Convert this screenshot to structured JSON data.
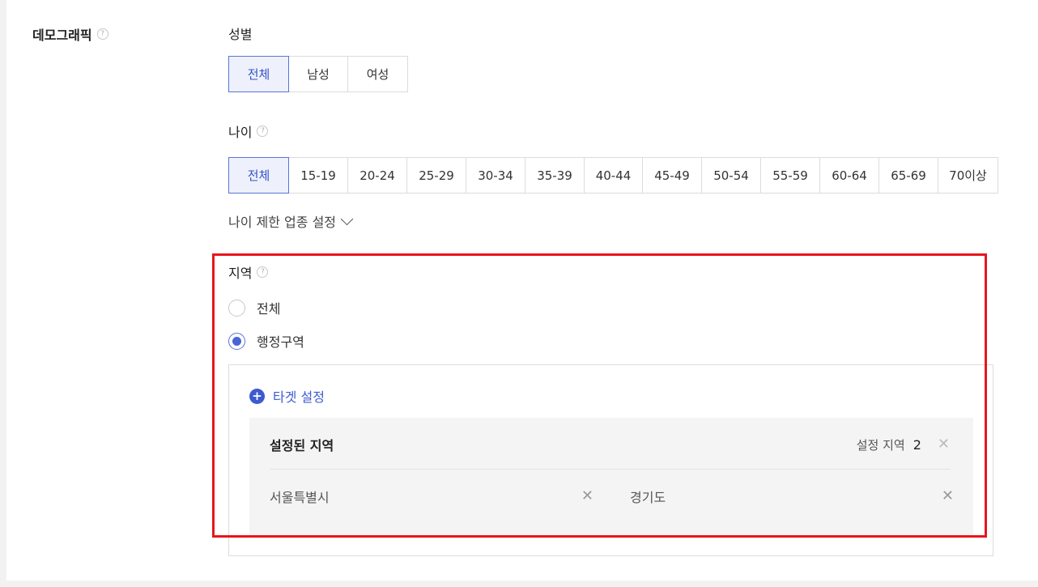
{
  "demographic": {
    "title": "데모그래픽",
    "help": "?"
  },
  "gender": {
    "label": "성별",
    "options": [
      "전체",
      "남성",
      "여성"
    ],
    "selected": "전체"
  },
  "age": {
    "label": "나이",
    "help": "?",
    "options": [
      "전체",
      "15-19",
      "20-24",
      "25-29",
      "30-34",
      "35-39",
      "40-44",
      "45-49",
      "50-54",
      "55-59",
      "60-64",
      "65-69",
      "70이상"
    ],
    "selected": "전체",
    "restrict_label": "나이 제한 업종 설정"
  },
  "region": {
    "label": "지역",
    "help": "?",
    "options": [
      {
        "label": "전체",
        "checked": false
      },
      {
        "label": "행정구역",
        "checked": true
      }
    ],
    "target_button": "타겟 설정",
    "panel_title": "설정된 지역",
    "count_label": "설정 지역",
    "count": "2",
    "items": [
      "서울특별시",
      "경기도"
    ]
  },
  "colors": {
    "accent": "#3d5bd0",
    "highlight": "#e8151b"
  }
}
